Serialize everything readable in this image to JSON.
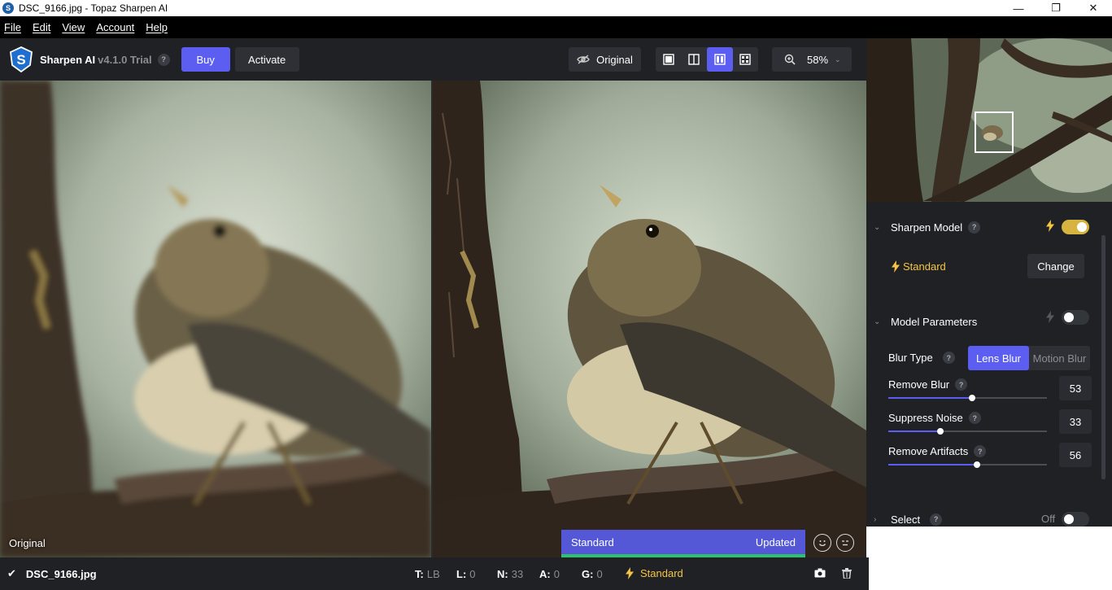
{
  "window": {
    "title": "DSC_9166.jpg - Topaz Sharpen AI",
    "app_icon_letter": "S",
    "controls": {
      "minimize": "—",
      "maximize": "❐",
      "close": "✕"
    }
  },
  "menu": {
    "items": [
      "File",
      "Edit",
      "View",
      "Account",
      "Help"
    ]
  },
  "toolbar": {
    "app_name": "Sharpen AI",
    "version": "v4.1.0 Trial",
    "help": "?",
    "buy_label": "Buy",
    "activate_label": "Activate",
    "original_label": "Original",
    "view_modes": [
      "single-view-icon",
      "split-view-icon",
      "side-by-side-view-icon",
      "quad-view-icon"
    ],
    "active_view": "side-by-side-view-icon",
    "zoom": "58%"
  },
  "preview": {
    "left_label": "Original",
    "model_status": {
      "model": "Standard",
      "state": "Updated"
    }
  },
  "status_bar": {
    "file_name": "DSC_9166.jpg",
    "stats": [
      {
        "key": "T:",
        "value": "LB"
      },
      {
        "key": "L:",
        "value": "0"
      },
      {
        "key": "N:",
        "value": "33"
      },
      {
        "key": "A:",
        "value": "0"
      },
      {
        "key": "G:",
        "value": "0"
      }
    ],
    "model": "Standard"
  },
  "sidebar": {
    "sharpen_model": {
      "title": "Sharpen Model",
      "help": "?",
      "enabled": true,
      "model_name": "Standard",
      "change_label": "Change"
    },
    "model_parameters": {
      "title": "Model Parameters",
      "help": "?",
      "enabled": false,
      "blur_type_label": "Blur Type",
      "blur_type_help": "?",
      "blur_options": [
        "Lens Blur",
        "Motion Blur"
      ],
      "blur_selected": "Lens Blur",
      "sliders": [
        {
          "label": "Remove Blur",
          "help": "?",
          "value": 53
        },
        {
          "label": "Suppress Noise",
          "help": "?",
          "value": 33
        },
        {
          "label": "Remove Artifacts",
          "help": "?",
          "value": 56
        }
      ]
    },
    "select": {
      "title": "Select",
      "help": "?",
      "state_label": "Off",
      "enabled": false
    }
  },
  "colors": {
    "accent": "#5b5ef1",
    "model_yellow": "#f5c542",
    "toggle_on": "#d7b43f",
    "panel_bg": "#1f2125",
    "progress_green": "#2bc46d"
  }
}
